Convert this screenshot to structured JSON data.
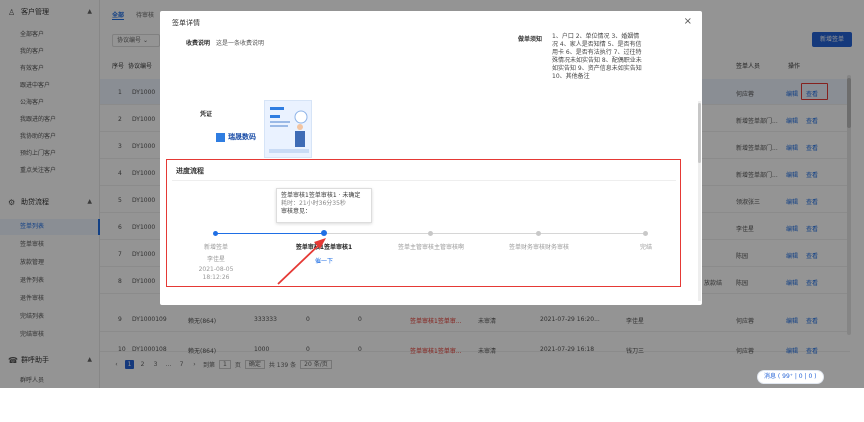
{
  "sidebar": {
    "groups": [
      {
        "label": "客户管理",
        "icon": "customer-icon",
        "items": [
          "全部客户",
          "我的客户",
          "有效客户",
          "跟进中客户",
          "公海客户",
          "我跟进的客户",
          "我协助的客户",
          "预约上门客户",
          "重点关注客户"
        ]
      },
      {
        "label": "助贷流程",
        "icon": "flow-icon",
        "items": [
          "签单列表",
          "签单审核",
          "放款管理",
          "退件列表",
          "退件审核",
          "完结列表",
          "完结审核"
        ],
        "active": "签单列表"
      },
      {
        "label": "群呼助手",
        "icon": "call-icon",
        "items": [
          "群呼人员"
        ]
      }
    ]
  },
  "main": {
    "tabs": [
      "全部",
      "待审核"
    ],
    "filter": "协议编号",
    "new_button": "新增签单",
    "headers": {
      "seq": "序号",
      "contract": "协议编号",
      "rep": "签单人员",
      "ops": "操作"
    },
    "rows": [
      {
        "seq": "1",
        "id": "DY1000",
        "rep": "何应蓉",
        "edit": "编辑",
        "view": "查看"
      },
      {
        "seq": "2",
        "id": "DY1000",
        "rep": "新增签单部门...",
        "edit": "编辑",
        "view": "查看"
      },
      {
        "seq": "3",
        "id": "DY1000",
        "rep": "新增签单部门...",
        "edit": "编辑",
        "view": "查看"
      },
      {
        "seq": "4",
        "id": "DY1000",
        "rep": "新增签单部门...",
        "edit": "编辑",
        "view": "查看"
      },
      {
        "seq": "5",
        "id": "DY1000",
        "rep": "领淑张三",
        "edit": "编辑",
        "view": "查看"
      },
      {
        "seq": "6",
        "id": "DY1000",
        "rep": "李佳星",
        "edit": "编辑",
        "view": "查看"
      },
      {
        "seq": "7",
        "id": "DY1000",
        "rep": "陈园",
        "edit": "编辑",
        "view": "查看"
      },
      {
        "seq": "8",
        "id": "DY1000",
        "extra": "放款结",
        "rep": "陈园",
        "edit": "编辑",
        "view": "查看"
      },
      {
        "seq": "9",
        "id": "DY1000109",
        "name": "赖无(864)",
        "amount": "333333",
        "z1": "0",
        "z2": "0",
        "status": "签单审核1签单审...",
        "state": "未审清",
        "date": "2021-07-29 16:20...",
        "owner": "李佳星",
        "rep": "何应蓉",
        "edit": "编辑",
        "view": "查看"
      },
      {
        "seq": "10",
        "id": "DY1000108",
        "name": "赖无(864)",
        "amount": "1000",
        "z1": "0",
        "z2": "0",
        "status": "签单审核1签单审...",
        "state": "未审清",
        "date": "2021-07-29 16:18",
        "owner": "钱刀三",
        "rep": "何应蓉",
        "edit": "编辑",
        "view": "查看"
      }
    ],
    "pager": {
      "pages": [
        "1",
        "2",
        "3",
        "...",
        "7"
      ],
      "goto": "到第",
      "page_input": "1",
      "page_unit": "页",
      "confirm": "确定",
      "total": "共 139 条",
      "per_page": "20 条/页"
    },
    "messages": "消息 ( 99⁺ | 0 | 0 )"
  },
  "modal": {
    "title": "签单详情",
    "close": "×",
    "deposit_label": "收费说明",
    "deposit_value": "这是一条收费说明",
    "notice_label": "做单须知",
    "notice_text": "1、户口 2、单位情况 3、婚姻情况 4、家人是否知情 5、是否有信用卡 6、是否有法执行 7、过往特殊情况未如实告知 8、配偶职业未如实告知 9、资产信息未如实告知 10、其他备注",
    "voucher_label": "凭证",
    "voucher_brand": "瑞晟数码",
    "progress_title": "进度流程",
    "tooltip": {
      "line1": "签单审核1签单审核1 · 未确定",
      "line2": "耗时：21小时36分35秒",
      "line3": "审核意见："
    },
    "steps": [
      {
        "label": "新增签单",
        "sub1": "李佳星",
        "sub2": "2021-08-05",
        "sub3": "18:12:26",
        "state": "done"
      },
      {
        "label": "签单审核1签单审核1",
        "sub1": "催一下",
        "state": "current"
      },
      {
        "label": "签单主管审核主管审核啊",
        "state": "todo"
      },
      {
        "label": "签单财务审核财务审核",
        "state": "todo"
      },
      {
        "label": "完结",
        "state": "todo"
      }
    ]
  }
}
